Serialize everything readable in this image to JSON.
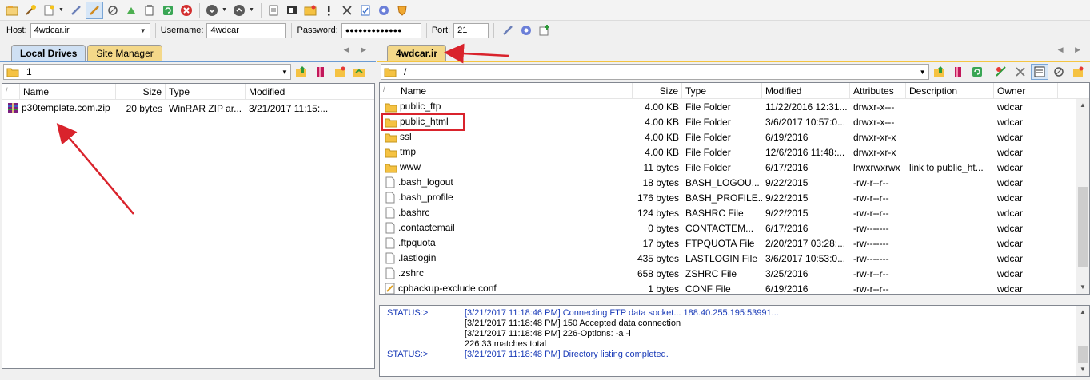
{
  "quick_connect": {
    "host_label": "Host:",
    "host_value": "4wdcar.ir",
    "username_label": "Username:",
    "username_value": "4wdcar",
    "password_label": "Password:",
    "password_value": "●●●●●●●●●●●●●",
    "port_label": "Port:",
    "port_value": "21"
  },
  "local": {
    "tabs": [
      "Local Drives",
      "Site Manager"
    ],
    "path": "1",
    "columns": [
      "Name",
      "Size",
      "Type",
      "Modified"
    ],
    "files": [
      {
        "name": "p30template.com.zip",
        "size": "20 bytes",
        "type": "WinRAR ZIP ar...",
        "modified": "3/21/2017 11:15:..."
      }
    ]
  },
  "remote": {
    "tab": "4wdcar.ir",
    "path": "/",
    "columns": [
      "Name",
      "Size",
      "Type",
      "Modified",
      "Attributes",
      "Description",
      "Owner"
    ],
    "files": [
      {
        "name": "public_ftp",
        "size": "4.00 KB",
        "type": "File Folder",
        "modified": "11/22/2016 12:31...",
        "attributes": "drwxr-x---",
        "description": "",
        "owner": "wdcar",
        "kind": "folder"
      },
      {
        "name": "public_html",
        "size": "4.00 KB",
        "type": "File Folder",
        "modified": "3/6/2017 10:57:0...",
        "attributes": "drwxr-x---",
        "description": "",
        "owner": "wdcar",
        "kind": "folder"
      },
      {
        "name": "ssl",
        "size": "4.00 KB",
        "type": "File Folder",
        "modified": "6/19/2016",
        "attributes": "drwxr-xr-x",
        "description": "",
        "owner": "wdcar",
        "kind": "folder"
      },
      {
        "name": "tmp",
        "size": "4.00 KB",
        "type": "File Folder",
        "modified": "12/6/2016 11:48:...",
        "attributes": "drwxr-xr-x",
        "description": "",
        "owner": "wdcar",
        "kind": "folder"
      },
      {
        "name": "www",
        "size": "11 bytes",
        "type": "File Folder",
        "modified": "6/17/2016",
        "attributes": "lrwxrwxrwx",
        "description": "link to public_ht...",
        "owner": "wdcar",
        "kind": "folder"
      },
      {
        "name": ".bash_logout",
        "size": "18 bytes",
        "type": "BASH_LOGOU...",
        "modified": "9/22/2015",
        "attributes": "-rw-r--r--",
        "description": "",
        "owner": "wdcar",
        "kind": "file"
      },
      {
        "name": ".bash_profile",
        "size": "176 bytes",
        "type": "BASH_PROFILE...",
        "modified": "9/22/2015",
        "attributes": "-rw-r--r--",
        "description": "",
        "owner": "wdcar",
        "kind": "file"
      },
      {
        "name": ".bashrc",
        "size": "124 bytes",
        "type": "BASHRC File",
        "modified": "9/22/2015",
        "attributes": "-rw-r--r--",
        "description": "",
        "owner": "wdcar",
        "kind": "file"
      },
      {
        "name": ".contactemail",
        "size": "0 bytes",
        "type": "CONTACTEM...",
        "modified": "6/17/2016",
        "attributes": "-rw-------",
        "description": "",
        "owner": "wdcar",
        "kind": "file"
      },
      {
        "name": ".ftpquota",
        "size": "17 bytes",
        "type": "FTPQUOTA File",
        "modified": "2/20/2017 03:28:...",
        "attributes": "-rw-------",
        "description": "",
        "owner": "wdcar",
        "kind": "file"
      },
      {
        "name": ".lastlogin",
        "size": "435 bytes",
        "type": "LASTLOGIN File",
        "modified": "3/6/2017 10:53:0...",
        "attributes": "-rw-------",
        "description": "",
        "owner": "wdcar",
        "kind": "file"
      },
      {
        "name": ".zshrc",
        "size": "658 bytes",
        "type": "ZSHRC File",
        "modified": "3/25/2016",
        "attributes": "-rw-r--r--",
        "description": "",
        "owner": "wdcar",
        "kind": "file"
      },
      {
        "name": "cpbackup-exclude.conf",
        "size": "1 bytes",
        "type": "CONF File",
        "modified": "6/19/2016",
        "attributes": "-rw-r--r--",
        "description": "",
        "owner": "wdcar",
        "kind": "conf"
      }
    ]
  },
  "log": [
    {
      "key": "STATUS:>",
      "text": "[3/21/2017 11:18:46 PM] Connecting FTP data socket... 188.40.255.195:53991...",
      "blue": true
    },
    {
      "key": "",
      "text": "[3/21/2017 11:18:48 PM] 150 Accepted data connection",
      "blue": false
    },
    {
      "key": "",
      "text": "[3/21/2017 11:18:48 PM] 226-Options: -a -l",
      "blue": false
    },
    {
      "key": "",
      "text": "226 33 matches total",
      "blue": false
    },
    {
      "key": "STATUS:>",
      "text": "[3/21/2017 11:18:48 PM] Directory listing completed.",
      "blue": true
    }
  ],
  "colors": {
    "annotation": "#d9232c",
    "log_blue": "#1a3bb8",
    "remote_tab": "#f4d889",
    "local_tab": "#cfe0f3"
  }
}
